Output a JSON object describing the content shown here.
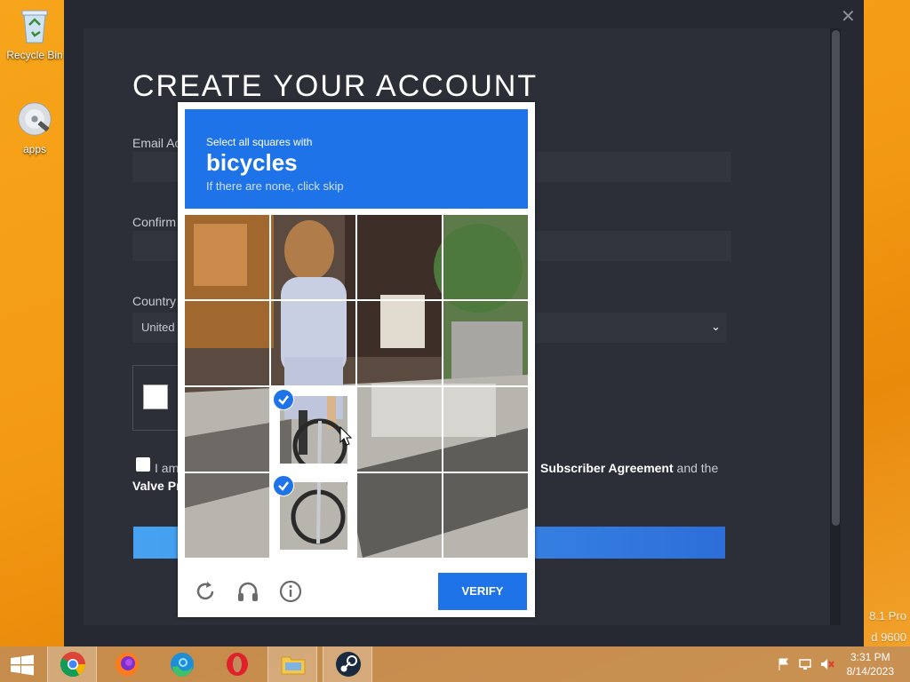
{
  "desktop": {
    "icons": [
      {
        "label": "Recycle Bin"
      },
      {
        "label": "apps"
      }
    ],
    "corner_line1": "8.1 Pro",
    "corner_line2": "d 9600"
  },
  "signup": {
    "title": "CREATE YOUR ACCOUNT",
    "email_label": "Email Ac",
    "confirm_label": "Confirm",
    "country_label": "Country",
    "country_value": "United",
    "agree_left": "I am",
    "agree_link": "Subscriber Agreement",
    "agree_right": "and the",
    "valve_line": "Valve Pr"
  },
  "captcha": {
    "prompt_pre": "Select all squares with",
    "prompt_word": "bicycles",
    "prompt_sub": "If there are none, click skip",
    "verify_label": "VERIFY",
    "selected_tiles": [
      9,
      13
    ],
    "accent_color": "#1f73e8"
  },
  "taskbar": {
    "apps": [
      "windows-start",
      "chrome",
      "firefox",
      "edge",
      "opera",
      "file-explorer",
      "steam"
    ],
    "time": "3:31 PM",
    "date": "8/14/2023"
  }
}
